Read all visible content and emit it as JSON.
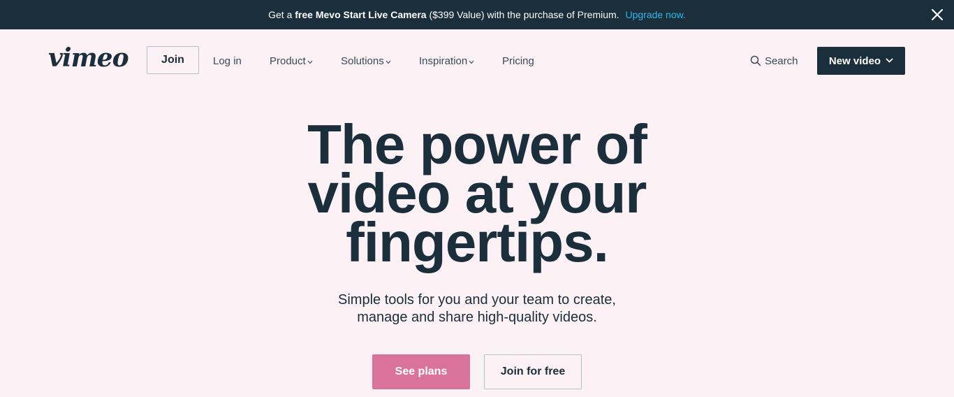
{
  "promo": {
    "prefix": "Get a",
    "bold": "free Mevo Start Live Camera",
    "suffix": "($399 Value) with the purchase of Premium.",
    "link": "Upgrade now.",
    "close_icon": "close-icon",
    "link_color": "#2fb9ea"
  },
  "header": {
    "logo": "vimeo",
    "join": "Join",
    "login": "Log in",
    "nav": {
      "product": "Product",
      "solutions": "Solutions",
      "inspiration": "Inspiration",
      "pricing": "Pricing"
    },
    "search": "Search",
    "search_icon": "search-icon",
    "new_video": "New video"
  },
  "hero": {
    "title_lines": [
      "The power of",
      "video at your",
      "fingertips."
    ],
    "subtitle_lines": [
      "Simple tools for you and your team to create,",
      "manage and share high-quality videos."
    ],
    "see_plans": "See plans",
    "join_free": "Join for free"
  },
  "colors": {
    "background": "#fcf1f4",
    "dark": "#1a2e3b",
    "accent_pink": "#d9739c"
  }
}
